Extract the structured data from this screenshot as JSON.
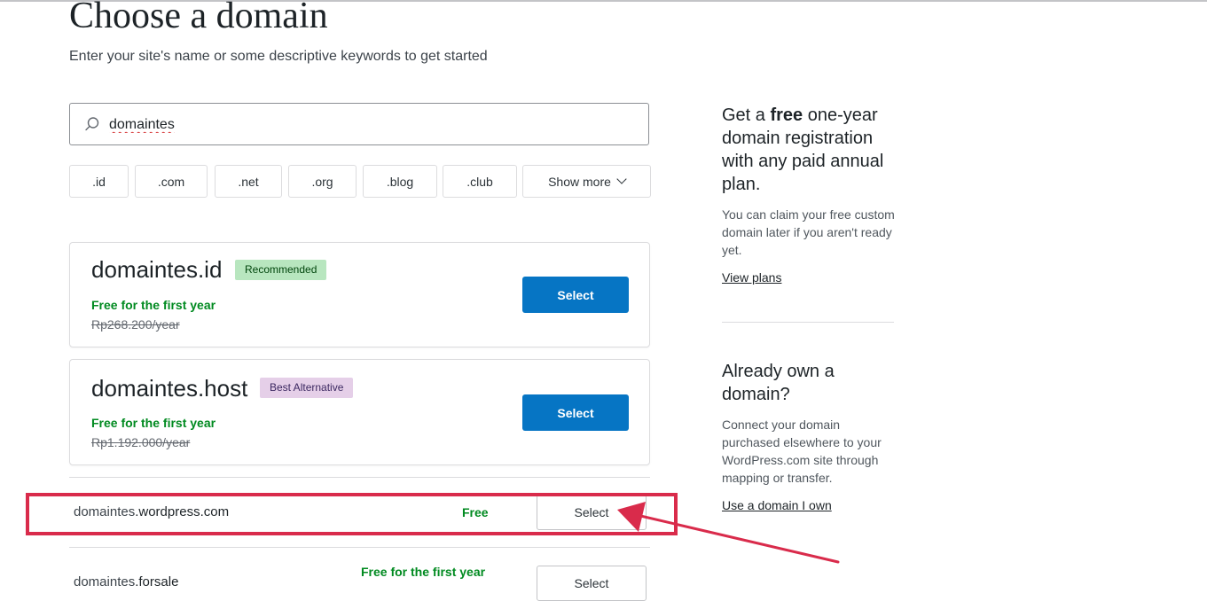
{
  "header": {
    "title": "Choose a domain",
    "subtitle": "Enter your site's name or some descriptive keywords to get started"
  },
  "search": {
    "value": "domaintes"
  },
  "tld_filters": [
    ".id",
    ".com",
    ".net",
    ".org",
    ".blog",
    ".club"
  ],
  "show_more_label": "Show more",
  "featured": [
    {
      "domain": "domaintes.id",
      "badge": "Recommended",
      "promo": "Free for the first year",
      "original_price": "Rp268.200/year",
      "button": "Select"
    },
    {
      "domain": "domaintes.host",
      "badge": "Best Alternative",
      "promo": "Free for the first year",
      "original_price": "Rp1.192.000/year",
      "button": "Select"
    }
  ],
  "results": [
    {
      "name_prefix": "domaintes",
      "name_suffix": ".wordpress.com",
      "price": "Free",
      "button": "Select"
    },
    {
      "name_prefix": "domaintes",
      "name_suffix": ".forsale",
      "price": "Free for the first year",
      "button": "Select"
    }
  ],
  "sidebar": {
    "promo_pre": "Get a ",
    "promo_bold": "free",
    "promo_post": " one-year domain registration with any paid annual plan.",
    "promo_text": "You can claim your free custom domain later if you aren't ready yet.",
    "promo_link": "View plans",
    "own_heading": "Already own a domain?",
    "own_text": "Connect your domain purchased elsewhere to your WordPress.com site through mapping or transfer.",
    "own_link": "Use a domain I own"
  },
  "colors": {
    "primary": "#0675c4",
    "success": "#008a20",
    "annotation": "#d92b4b"
  }
}
